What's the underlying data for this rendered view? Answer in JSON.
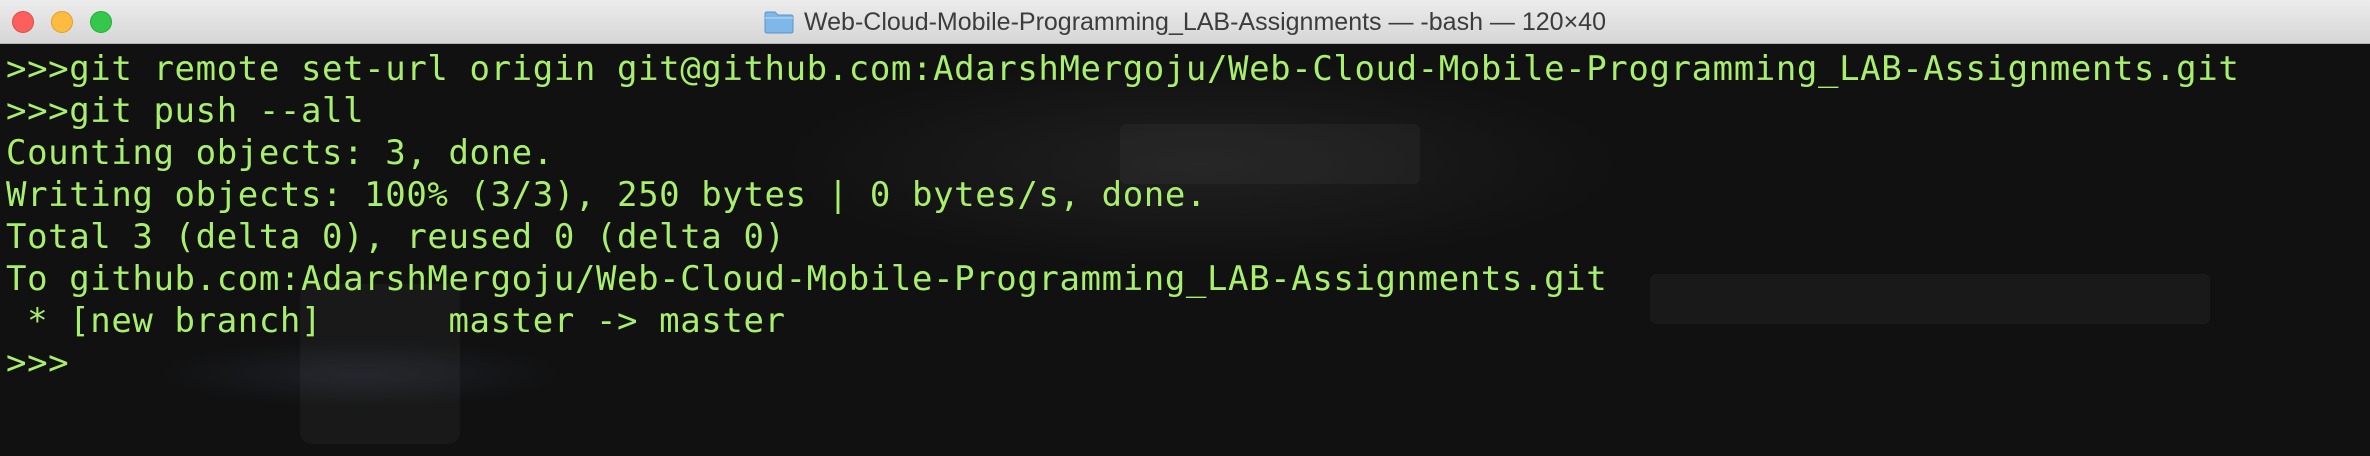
{
  "window": {
    "title": "Web-Cloud-Mobile-Programming_LAB-Assignments — -bash — 120×40"
  },
  "terminal": {
    "lines": [
      ">>>git remote set-url origin git@github.com:AdarshMergoju/Web-Cloud-Mobile-Programming_LAB-Assignments.git",
      ">>>git push --all",
      "Counting objects: 3, done.",
      "Writing objects: 100% (3/3), 250 bytes | 0 bytes/s, done.",
      "Total 3 (delta 0), reused 0 (delta 0)",
      "To github.com:AdarshMergoju/Web-Cloud-Mobile-Programming_LAB-Assignments.git",
      " * [new branch]      master -> master",
      ">>>"
    ],
    "text_color": "#a9ef6e",
    "background_color": "#111111"
  },
  "icons": {
    "title_icon": "folder-icon"
  }
}
